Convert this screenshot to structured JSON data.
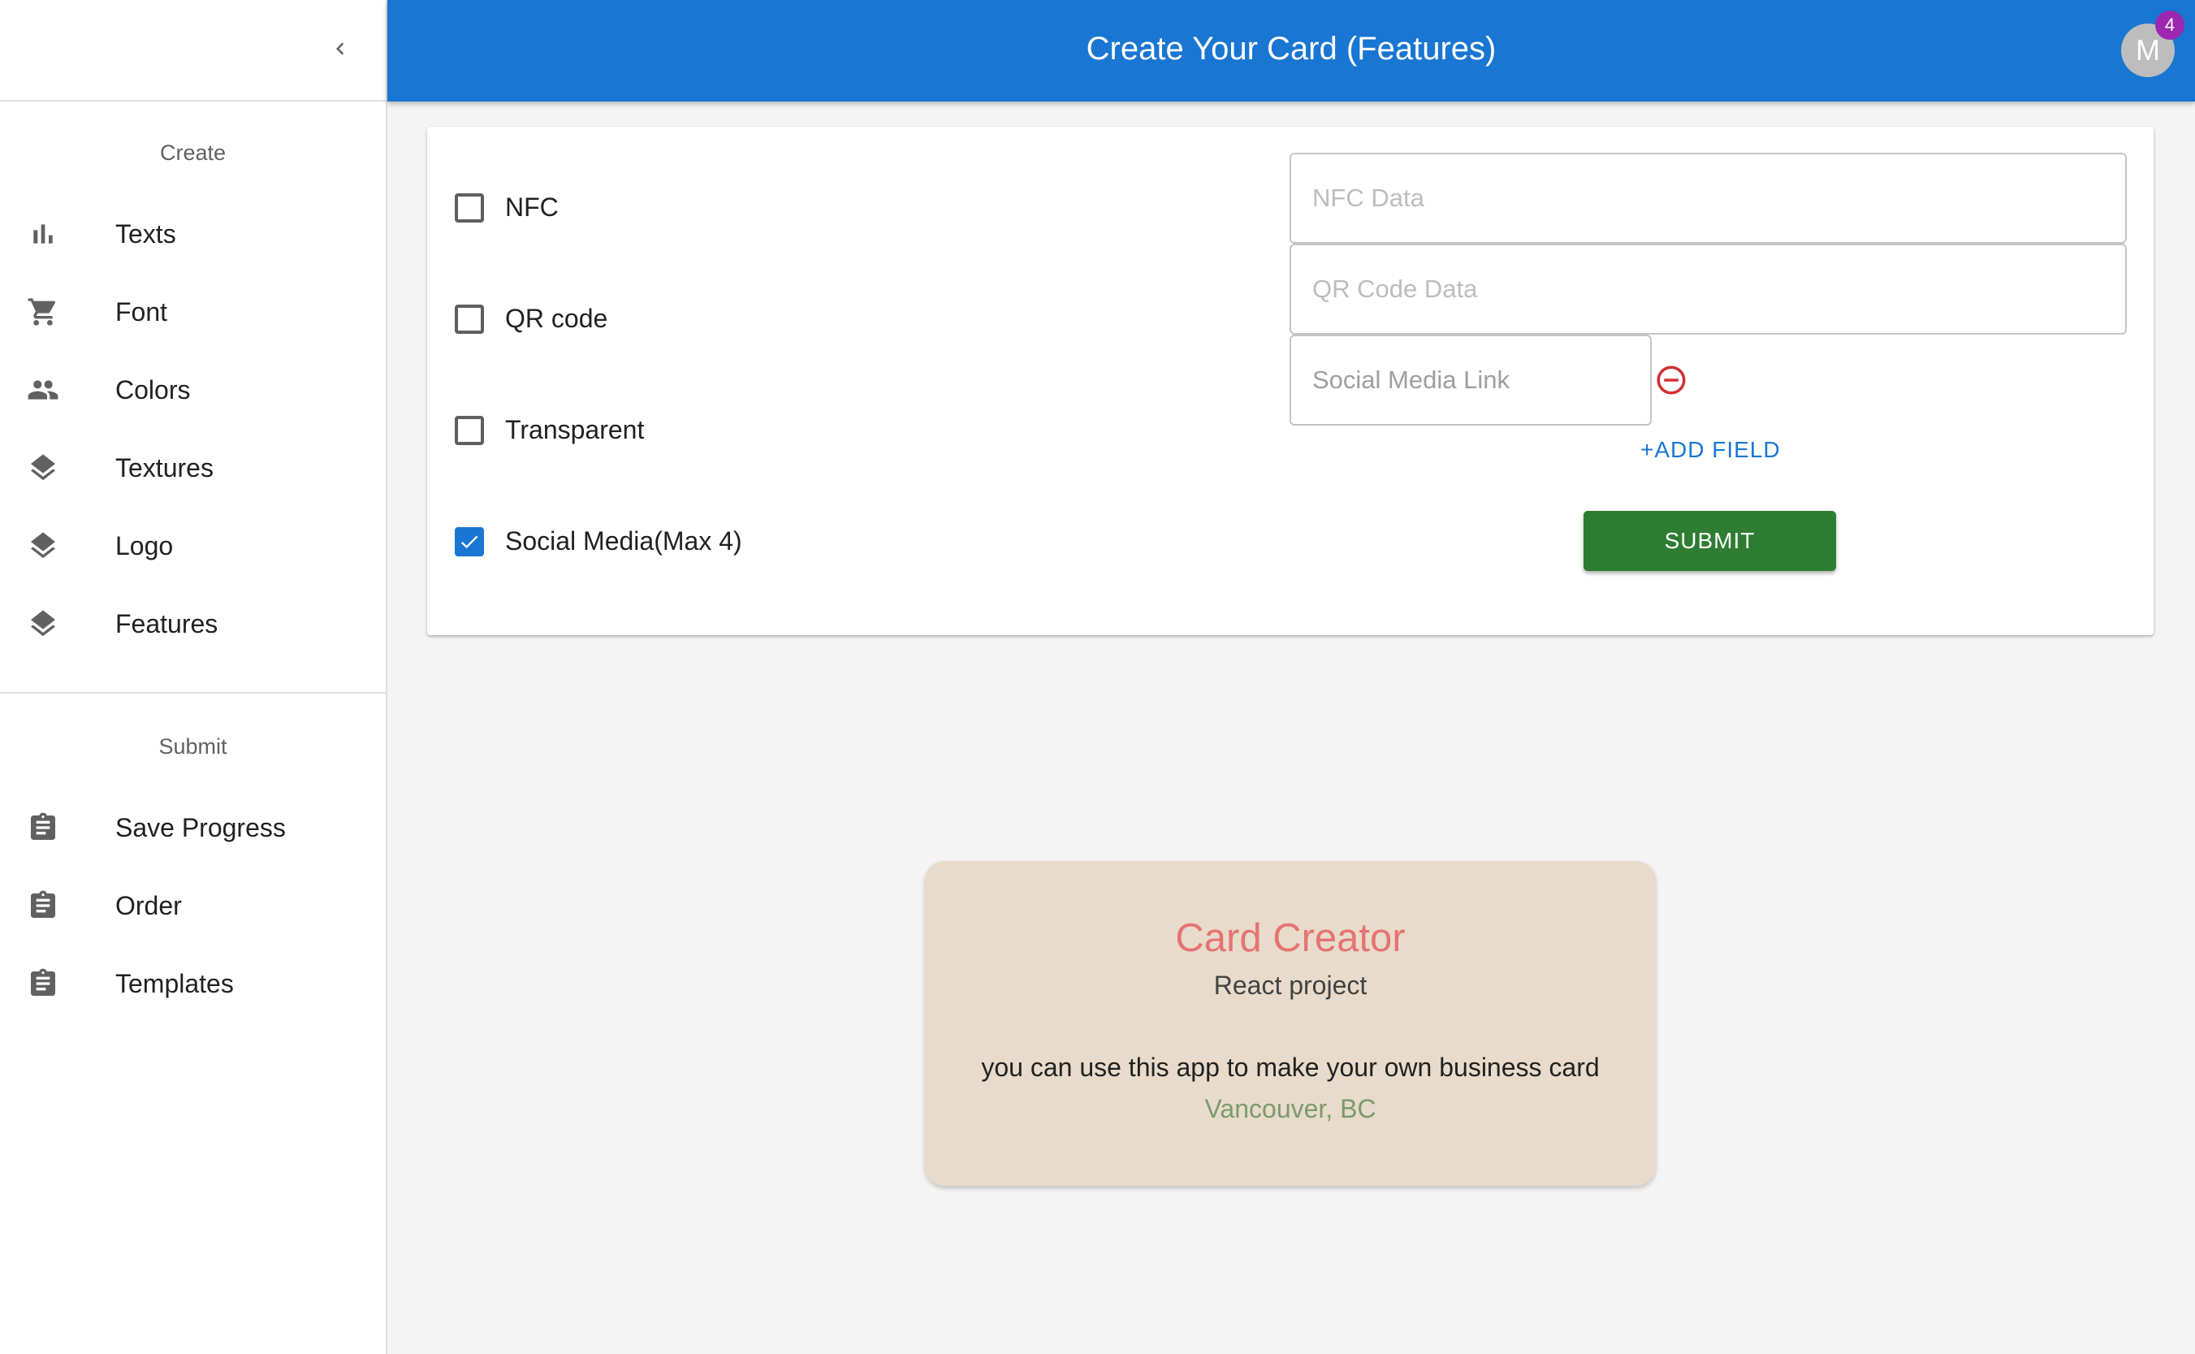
{
  "appbar": {
    "title": "Create Your Card (Features)",
    "avatar_letter": "M",
    "badge_count": "4"
  },
  "sidebar": {
    "create_title": "Create",
    "create_items": [
      {
        "label": "Texts",
        "icon": "bar-chart-icon"
      },
      {
        "label": "Font",
        "icon": "cart-icon"
      },
      {
        "label": "Colors",
        "icon": "people-icon"
      },
      {
        "label": "Textures",
        "icon": "layers-icon"
      },
      {
        "label": "Logo",
        "icon": "layers-icon"
      },
      {
        "label": "Features",
        "icon": "layers-icon"
      }
    ],
    "submit_title": "Submit",
    "submit_items": [
      {
        "label": "Save Progress",
        "icon": "clipboard-icon"
      },
      {
        "label": "Order",
        "icon": "clipboard-icon"
      },
      {
        "label": "Templates",
        "icon": "clipboard-icon"
      }
    ]
  },
  "form": {
    "options": [
      {
        "label": "NFC",
        "checked": false
      },
      {
        "label": "QR code",
        "checked": false
      },
      {
        "label": "Transparent",
        "checked": false
      },
      {
        "label": "Social Media(Max 4)",
        "checked": true
      }
    ],
    "nfc_placeholder": "NFC Data",
    "qr_placeholder": "QR Code Data",
    "social_placeholder": "Social Media Link",
    "add_field_label": "+ADD FIELD",
    "submit_label": "SUBMIT"
  },
  "card": {
    "title": "Card Creator",
    "subtitle": "React project",
    "description": "you can use this app to make your own business card",
    "location": "Vancouver, BC"
  },
  "colors": {
    "primary": "#1976d2",
    "submit": "#2e7d32",
    "card_bg": "#e8dbcb",
    "card_title": "#e57373",
    "remove": "#d32f2f",
    "badge": "#9c27b0"
  }
}
